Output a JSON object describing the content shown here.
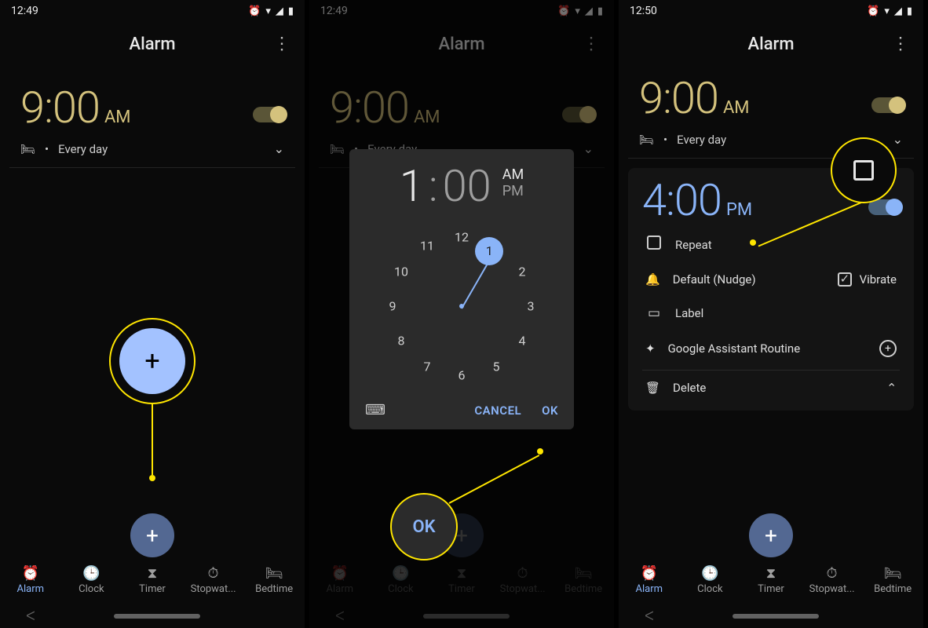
{
  "panel1": {
    "status_time": "12:49",
    "app_title": "Alarm",
    "alarm_time": "9:00",
    "alarm_ampm": "AM",
    "schedule": "Every day",
    "fab_glyph": "+",
    "hl_fab_glyph": "+",
    "nav": {
      "alarm": "Alarm",
      "clock": "Clock",
      "timer": "Timer",
      "stopwatch": "Stopwat...",
      "bedtime": "Bedtime"
    }
  },
  "panel2": {
    "status_time": "12:49",
    "app_title": "Alarm",
    "alarm_time": "9:00",
    "alarm_ampm": "AM",
    "schedule": "Every day",
    "dialog": {
      "hour": "1",
      "colon": ":",
      "minute": "00",
      "am": "AM",
      "pm": "PM",
      "numbers": [
        "12",
        "1",
        "2",
        "3",
        "4",
        "5",
        "6",
        "7",
        "8",
        "9",
        "10",
        "11"
      ],
      "cancel": "CANCEL",
      "ok": "OK"
    },
    "hl_ok": "OK",
    "nav": {
      "alarm": "Alarm",
      "clock": "Clock",
      "timer": "Timer",
      "stopwatch": "Stopwat...",
      "bedtime": "Bedtime"
    }
  },
  "panel3": {
    "status_time": "12:50",
    "app_title": "Alarm",
    "alarm1_time": "9:00",
    "alarm1_ampm": "AM",
    "alarm1_schedule": "Every day",
    "alarm2_time": "4:00",
    "alarm2_ampm": "PM",
    "repeat": "Repeat",
    "sound": "Default (Nudge)",
    "vibrate": "Vibrate",
    "label": "Label",
    "gar": "Google Assistant Routine",
    "delete": "Delete",
    "fab_glyph": "+",
    "nav": {
      "alarm": "Alarm",
      "clock": "Clock",
      "timer": "Timer",
      "stopwatch": "Stopwat...",
      "bedtime": "Bedtime"
    }
  }
}
